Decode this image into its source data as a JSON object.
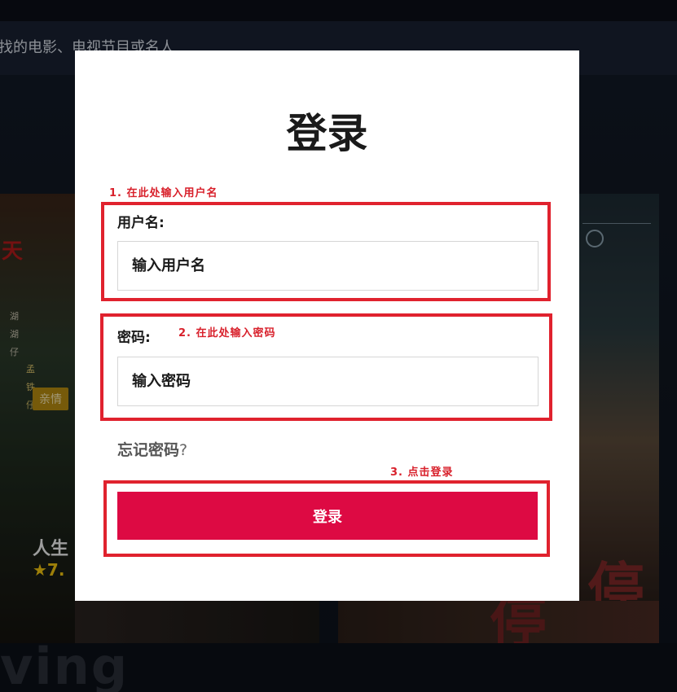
{
  "background": {
    "search_text": "找的电影、电视节目或名人",
    "left_poster": {
      "title": "天",
      "vertical_text_1": "湖 湖 仔",
      "vertical_text_2": "孟 铁 仔",
      "genre_tag": "亲情",
      "movie_title": "人生",
      "rating": "★7."
    },
    "right_poster": {
      "big_char": "停",
      "big_char_2": "停"
    },
    "bottom_word": "ving"
  },
  "modal": {
    "title": "登录",
    "annotations": {
      "step1": "1. 在此处输入用户名",
      "step2": "2. 在此处输入密码",
      "step3": "3. 点击登录"
    },
    "username": {
      "label": "用户名:",
      "placeholder": "输入用户名",
      "value": ""
    },
    "password": {
      "label": "密码:",
      "placeholder": "输入密码",
      "value": ""
    },
    "forgot_password": {
      "text": "忘记密码",
      "question_mark": "?"
    },
    "login_button": "登录"
  },
  "colors": {
    "accent": "#dd0a43",
    "annotation_red": "#e0222e",
    "modal_bg": "#ffffff",
    "page_bg": "#0e1420"
  }
}
